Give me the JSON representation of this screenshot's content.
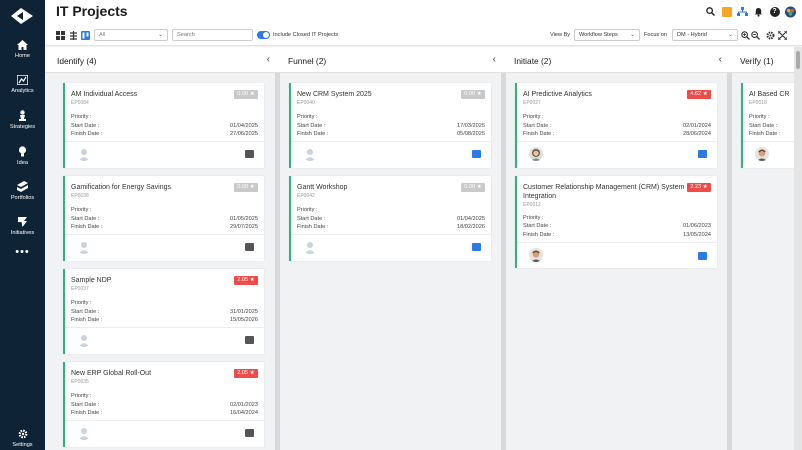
{
  "app": {
    "title": "IT Projects"
  },
  "sidebar": {
    "items": [
      {
        "label": "Home",
        "icon": "home-icon"
      },
      {
        "label": "Analytics",
        "icon": "analytics-icon"
      },
      {
        "label": "Strategies",
        "icon": "strategies-icon"
      },
      {
        "label": "Idea",
        "icon": "lightbulb-icon"
      },
      {
        "label": "Portfolios",
        "icon": "portfolios-icon"
      },
      {
        "label": "Initiatives",
        "icon": "initiatives-icon"
      }
    ],
    "more": "•••",
    "settings": "Settings"
  },
  "toolbar": {
    "filter_select": "All",
    "search_placeholder": "Search",
    "include_closed_label": "Include Closed IT Projects",
    "view_by_label": "View By",
    "view_by_value": "Workflow Steps",
    "focus_on_label": "Focus on",
    "focus_on_value": "DM - Hybrid"
  },
  "columns": [
    {
      "title": "Identify (4)",
      "cards": [
        {
          "title": "AM Individual Access",
          "id": "EP0084",
          "score": "0.00",
          "score_type": "grey",
          "priority_label": "Priority :",
          "priority": "",
          "start_label": "Start Date :",
          "start": "01/04/2025",
          "finish_label": "Finish Date :",
          "finish": "27/06/2025",
          "chat": "dark"
        },
        {
          "title": "Gamification for Energy Savings",
          "id": "EP0038",
          "score": "0.00",
          "score_type": "grey",
          "priority_label": "Priority :",
          "priority": "",
          "start_label": "Start Date :",
          "start": "01/05/2025",
          "finish_label": "Finish Date :",
          "finish": "29/07/2025",
          "chat": "dark"
        },
        {
          "title": "Sample NDP",
          "id": "EP0037",
          "score": "2.05",
          "score_type": "red",
          "priority_label": "Priority :",
          "priority": "",
          "start_label": "Start Date :",
          "start": "31/01/2025",
          "finish_label": "Finish Date :",
          "finish": "15/05/2026",
          "chat": "dark"
        },
        {
          "title": "New ERP Global Roll-Out",
          "id": "EP0035",
          "score": "2.05",
          "score_type": "red",
          "priority_label": "Priority :",
          "priority": "",
          "start_label": "Start Date :",
          "start": "02/01/2023",
          "finish_label": "Finish Date :",
          "finish": "16/04/2024",
          "chat": "dark"
        }
      ]
    },
    {
      "title": "Funnel (2)",
      "cards": [
        {
          "title": "New CRM System 2025",
          "id": "EP0040",
          "score": "0.00",
          "score_type": "grey",
          "priority_label": "Priority :",
          "priority": "",
          "start_label": "Start Date :",
          "start": "17/03/2025",
          "finish_label": "Finish Date :",
          "finish": "05/08/2025",
          "chat": "blue"
        },
        {
          "title": "Gantt Workshop",
          "id": "EP0042",
          "score": "0.00",
          "score_type": "grey",
          "priority_label": "Priority :",
          "priority": "",
          "start_label": "Start Date :",
          "start": "01/04/2025",
          "finish_label": "Finish Date :",
          "finish": "18/02/2026",
          "chat": "blue"
        }
      ]
    },
    {
      "title": "Initiate (2)",
      "cards": [
        {
          "title": "AI Predictive Analytics",
          "id": "EP0027",
          "score": "4.62",
          "score_type": "red",
          "priority_label": "Priority :",
          "priority": "",
          "start_label": "Start Date :",
          "start": "02/01/2024",
          "finish_label": "Finish Date :",
          "finish": "28/06/2024",
          "chat": "blue"
        },
        {
          "title": "Customer Relationship Management (CRM) System Integration",
          "id": "EP0012",
          "score": "2.23",
          "score_type": "red",
          "priority_label": "Priority :",
          "priority": "",
          "start_label": "Start Date :",
          "start": "01/06/2023",
          "finish_label": "Finish Date :",
          "finish": "13/05/2024",
          "chat": "blue"
        }
      ]
    },
    {
      "title": "Verify (1)",
      "cards": [
        {
          "title": "AI Based CR",
          "id": "EP0018",
          "priority_label": "Priority :",
          "start_label": "Start Date :",
          "finish_label": "Finish Date :"
        }
      ]
    }
  ]
}
